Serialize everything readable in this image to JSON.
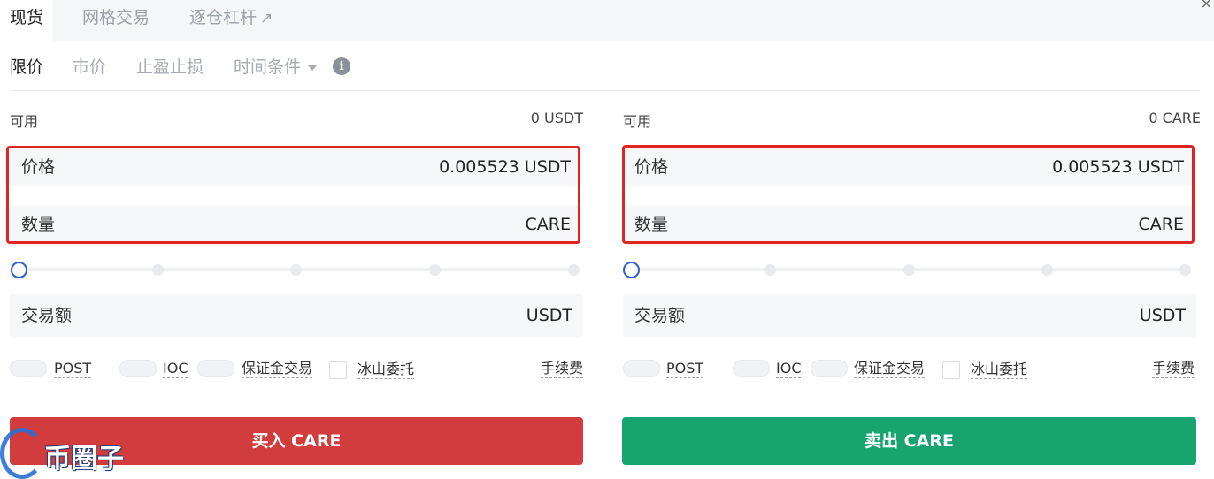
{
  "tabs": [
    {
      "label": "现货",
      "active": true
    },
    {
      "label": "网格交易",
      "active": false
    },
    {
      "label": "逐仓杠杆",
      "active": false,
      "icon": "external-link-icon"
    }
  ],
  "order_types": [
    {
      "label": "限价",
      "active": true
    },
    {
      "label": "市价",
      "active": false
    },
    {
      "label": "止盈止损",
      "active": false
    },
    {
      "label": "时间条件",
      "active": false
    }
  ],
  "buy": {
    "available_label": "可用",
    "available_value": "0 USDT",
    "price_label": "价格",
    "price_value": "0.005523 USDT",
    "amount_label": "数量",
    "amount_unit": "CARE",
    "slider_percent": 0,
    "total_label": "交易额",
    "total_unit": "USDT",
    "options": {
      "post": "POST",
      "ioc": "IOC",
      "margin": "保证金交易",
      "iceberg": "冰山委托",
      "fee": "手续费"
    },
    "button_label": "买入 CARE",
    "button_color": "#d23c3c"
  },
  "sell": {
    "available_label": "可用",
    "available_value": "0 CARE",
    "price_label": "价格",
    "price_value": "0.005523 USDT",
    "amount_label": "数量",
    "amount_unit": "CARE",
    "slider_percent": 0,
    "total_label": "交易额",
    "total_unit": "USDT",
    "options": {
      "post": "POST",
      "ioc": "IOC",
      "margin": "保证金交易",
      "iceberg": "冰山委托",
      "fee": "手续费"
    },
    "button_label": "卖出 CARE",
    "button_color": "#19a46f"
  },
  "highlight_color": "#e02424",
  "slider_accent": "#2b5fcf",
  "watermark": {
    "text": "币圈子"
  }
}
